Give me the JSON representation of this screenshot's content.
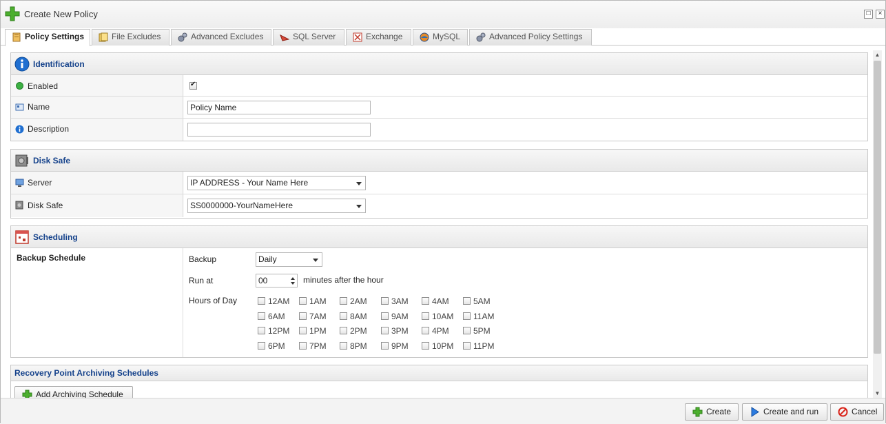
{
  "window": {
    "title": "Create New Policy"
  },
  "tabs": [
    {
      "label": "Policy Settings",
      "icon": "policy-settings-icon",
      "active": true
    },
    {
      "label": "File Excludes",
      "icon": "file-excludes-icon"
    },
    {
      "label": "Advanced Excludes",
      "icon": "gears-icon"
    },
    {
      "label": "SQL Server",
      "icon": "sql-server-icon"
    },
    {
      "label": "Exchange",
      "icon": "exchange-icon"
    },
    {
      "label": "MySQL",
      "icon": "mysql-icon"
    },
    {
      "label": "Advanced Policy Settings",
      "icon": "gears-icon"
    }
  ],
  "identification": {
    "title": "Identification",
    "enabled_label": "Enabled",
    "enabled_checked": true,
    "name_label": "Name",
    "name_value": "Policy Name",
    "description_label": "Description",
    "description_value": ""
  },
  "disk_safe": {
    "title": "Disk Safe",
    "server_label": "Server",
    "server_value": "IP ADDRESS - Your Name Here",
    "disk_safe_label": "Disk Safe",
    "disk_safe_value": "SS0000000-YourNameHere"
  },
  "scheduling": {
    "title": "Scheduling",
    "backup_schedule_label": "Backup Schedule",
    "backup_label": "Backup",
    "backup_value": "Daily",
    "run_at_label": "Run at",
    "run_at_value": "00",
    "run_at_suffix": "minutes after the hour",
    "hours_label": "Hours of Day",
    "hours": [
      "12AM",
      "1AM",
      "2AM",
      "3AM",
      "4AM",
      "5AM",
      "6AM",
      "7AM",
      "8AM",
      "9AM",
      "10AM",
      "11AM",
      "12PM",
      "1PM",
      "2PM",
      "3PM",
      "4PM",
      "5PM",
      "6PM",
      "7PM",
      "8PM",
      "9PM",
      "10PM",
      "11PM"
    ]
  },
  "archiving": {
    "title": "Recovery Point Archiving Schedules",
    "add_button": "Add Archiving Schedule"
  },
  "footer": {
    "create": "Create",
    "create_and_run": "Create and run",
    "cancel": "Cancel"
  },
  "colors": {
    "section_title": "#15428b",
    "enabled_dot": "#3cb043",
    "accent_blue": "#1f6fd1"
  }
}
